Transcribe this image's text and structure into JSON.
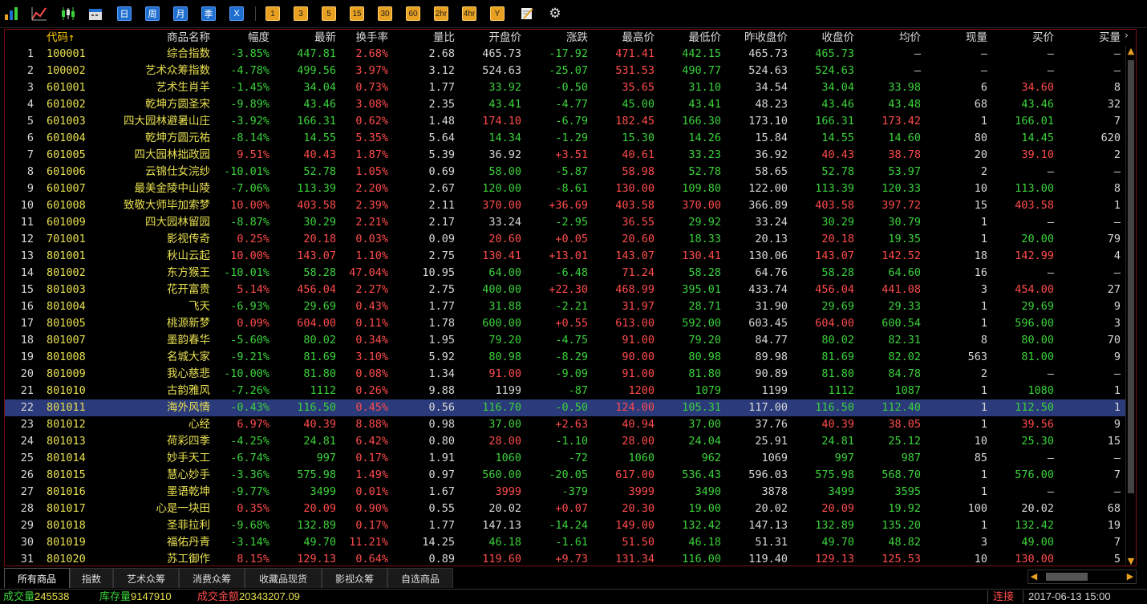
{
  "toolbar": {
    "icons": [
      "bar-chart-icon",
      "line-chart-icon",
      "candlestick-icon",
      "calendar-icon"
    ],
    "period_buttons": [
      "日",
      "周",
      "月",
      "季",
      "X"
    ],
    "interval_buttons": [
      "1",
      "3",
      "5",
      "15",
      "30",
      "60",
      "2hr",
      "4hr",
      "Y"
    ],
    "tools": [
      "note-icon",
      "gear-icon"
    ]
  },
  "table": {
    "headers": {
      "code": "代码↑",
      "name": "商品名称",
      "change_pct": "幅度",
      "last": "最新",
      "turnover": "换手率",
      "volume_ratio": "量比",
      "open": "开盘价",
      "change": "涨跌",
      "high": "最高价",
      "low": "最低价",
      "prev_close": "昨收盘价",
      "close": "收盘价",
      "avg": "均价",
      "cur_vol": "现量",
      "bid": "买价",
      "bid_vol": "买量"
    },
    "rows": [
      {
        "idx": "1",
        "code": "100001",
        "name": "综合指数",
        "pct": "-3.85%",
        "last": "447.81",
        "turn": "2.68%",
        "vr": "2.68",
        "open": "465.73",
        "chg": "-17.92",
        "high": "471.41",
        "low": "442.15",
        "prev": "465.73",
        "close": "465.73",
        "avg": "—",
        "cv": "—",
        "bid": "—",
        "bv": "—"
      },
      {
        "idx": "2",
        "code": "100002",
        "name": "艺术众筹指数",
        "pct": "-4.78%",
        "last": "499.56",
        "turn": "3.97%",
        "vr": "3.12",
        "open": "524.63",
        "chg": "-25.07",
        "high": "531.53",
        "low": "490.77",
        "prev": "524.63",
        "close": "524.63",
        "avg": "—",
        "cv": "—",
        "bid": "—",
        "bv": "—"
      },
      {
        "idx": "3",
        "code": "601001",
        "name": "艺术生肖羊",
        "pct": "-1.45%",
        "last": "34.04",
        "turn": "0.73%",
        "vr": "1.77",
        "open": "33.92",
        "chg": "-0.50",
        "high": "35.65",
        "low": "31.10",
        "prev": "34.54",
        "close": "34.04",
        "avg": "33.98",
        "cv": "6",
        "bid": "34.60",
        "bv": "8"
      },
      {
        "idx": "4",
        "code": "601002",
        "name": "乾坤方圆圣宋",
        "pct": "-9.89%",
        "last": "43.46",
        "turn": "3.08%",
        "vr": "2.35",
        "open": "43.41",
        "chg": "-4.77",
        "high": "45.00",
        "low": "43.41",
        "prev": "48.23",
        "close": "43.46",
        "avg": "43.48",
        "cv": "68",
        "bid": "43.46",
        "bv": "32"
      },
      {
        "idx": "5",
        "code": "601003",
        "name": "四大园林避暑山庄",
        "pct": "-3.92%",
        "last": "166.31",
        "turn": "0.62%",
        "vr": "1.48",
        "open": "174.10",
        "chg": "-6.79",
        "high": "182.45",
        "low": "166.30",
        "prev": "173.10",
        "close": "166.31",
        "avg": "173.42",
        "cv": "1",
        "bid": "166.01",
        "bv": "7"
      },
      {
        "idx": "6",
        "code": "601004",
        "name": "乾坤方圆元祐",
        "pct": "-8.14%",
        "last": "14.55",
        "turn": "5.35%",
        "vr": "5.64",
        "open": "14.34",
        "chg": "-1.29",
        "high": "15.30",
        "low": "14.26",
        "prev": "15.84",
        "close": "14.55",
        "avg": "14.60",
        "cv": "80",
        "bid": "14.45",
        "bv": "620"
      },
      {
        "idx": "7",
        "code": "601005",
        "name": "四大园林拙政园",
        "pct": "9.51%",
        "last": "40.43",
        "turn": "1.87%",
        "vr": "5.39",
        "open": "36.92",
        "chg": "+3.51",
        "high": "40.61",
        "low": "33.23",
        "prev": "36.92",
        "close": "40.43",
        "avg": "38.78",
        "cv": "20",
        "bid": "39.10",
        "bv": "2"
      },
      {
        "idx": "8",
        "code": "601006",
        "name": "云锦仕女浣纱",
        "pct": "-10.01%",
        "last": "52.78",
        "turn": "1.05%",
        "vr": "0.69",
        "open": "58.00",
        "chg": "-5.87",
        "high": "58.98",
        "low": "52.78",
        "prev": "58.65",
        "close": "52.78",
        "avg": "53.97",
        "cv": "2",
        "bid": "—",
        "bv": "—"
      },
      {
        "idx": "9",
        "code": "601007",
        "name": "最美金陵中山陵",
        "pct": "-7.06%",
        "last": "113.39",
        "turn": "2.20%",
        "vr": "2.67",
        "open": "120.00",
        "chg": "-8.61",
        "high": "130.00",
        "low": "109.80",
        "prev": "122.00",
        "close": "113.39",
        "avg": "120.33",
        "cv": "10",
        "bid": "113.00",
        "bv": "8"
      },
      {
        "idx": "10",
        "code": "601008",
        "name": "致敬大师毕加索梦",
        "pct": "10.00%",
        "last": "403.58",
        "turn": "2.39%",
        "vr": "2.11",
        "open": "370.00",
        "chg": "+36.69",
        "high": "403.58",
        "low": "370.00",
        "prev": "366.89",
        "close": "403.58",
        "avg": "397.72",
        "cv": "15",
        "bid": "403.58",
        "bv": "1"
      },
      {
        "idx": "11",
        "code": "601009",
        "name": "四大园林留园",
        "pct": "-8.87%",
        "last": "30.29",
        "turn": "2.21%",
        "vr": "2.17",
        "open": "33.24",
        "chg": "-2.95",
        "high": "36.55",
        "low": "29.92",
        "prev": "33.24",
        "close": "30.29",
        "avg": "30.79",
        "cv": "1",
        "bid": "—",
        "bv": "—"
      },
      {
        "idx": "12",
        "code": "701001",
        "name": "影视传奇",
        "pct": "0.25%",
        "last": "20.18",
        "turn": "0.03%",
        "vr": "0.09",
        "open": "20.60",
        "chg": "+0.05",
        "high": "20.60",
        "low": "18.33",
        "prev": "20.13",
        "close": "20.18",
        "avg": "19.35",
        "cv": "1",
        "bid": "20.00",
        "bv": "79"
      },
      {
        "idx": "13",
        "code": "801001",
        "name": "秋山云起",
        "pct": "10.00%",
        "last": "143.07",
        "turn": "1.10%",
        "vr": "2.75",
        "open": "130.41",
        "chg": "+13.01",
        "high": "143.07",
        "low": "130.41",
        "prev": "130.06",
        "close": "143.07",
        "avg": "142.52",
        "cv": "18",
        "bid": "142.99",
        "bv": "4"
      },
      {
        "idx": "14",
        "code": "801002",
        "name": "东方猴王",
        "pct": "-10.01%",
        "last": "58.28",
        "turn": "47.04%",
        "vr": "10.95",
        "open": "64.00",
        "chg": "-6.48",
        "high": "71.24",
        "low": "58.28",
        "prev": "64.76",
        "close": "58.28",
        "avg": "64.60",
        "cv": "16",
        "bid": "—",
        "bv": "—"
      },
      {
        "idx": "15",
        "code": "801003",
        "name": "花开富贵",
        "pct": "5.14%",
        "last": "456.04",
        "turn": "2.27%",
        "vr": "2.75",
        "open": "400.00",
        "chg": "+22.30",
        "high": "468.99",
        "low": "395.01",
        "prev": "433.74",
        "close": "456.04",
        "avg": "441.08",
        "cv": "3",
        "bid": "454.00",
        "bv": "27"
      },
      {
        "idx": "16",
        "code": "801004",
        "name": "飞天",
        "pct": "-6.93%",
        "last": "29.69",
        "turn": "0.43%",
        "vr": "1.77",
        "open": "31.88",
        "chg": "-2.21",
        "high": "31.97",
        "low": "28.71",
        "prev": "31.90",
        "close": "29.69",
        "avg": "29.33",
        "cv": "1",
        "bid": "29.69",
        "bv": "9"
      },
      {
        "idx": "17",
        "code": "801005",
        "name": "桃源新梦",
        "pct": "0.09%",
        "last": "604.00",
        "turn": "0.11%",
        "vr": "1.78",
        "open": "600.00",
        "chg": "+0.55",
        "high": "613.00",
        "low": "592.00",
        "prev": "603.45",
        "close": "604.00",
        "avg": "600.54",
        "cv": "1",
        "bid": "596.00",
        "bv": "3"
      },
      {
        "idx": "18",
        "code": "801007",
        "name": "墨韵春华",
        "pct": "-5.60%",
        "last": "80.02",
        "turn": "0.34%",
        "vr": "1.95",
        "open": "79.20",
        "chg": "-4.75",
        "high": "91.00",
        "low": "79.20",
        "prev": "84.77",
        "close": "80.02",
        "avg": "82.31",
        "cv": "8",
        "bid": "80.00",
        "bv": "70"
      },
      {
        "idx": "19",
        "code": "801008",
        "name": "名城大家",
        "pct": "-9.21%",
        "last": "81.69",
        "turn": "3.10%",
        "vr": "5.92",
        "open": "80.98",
        "chg": "-8.29",
        "high": "90.00",
        "low": "80.98",
        "prev": "89.98",
        "close": "81.69",
        "avg": "82.02",
        "cv": "563",
        "bid": "81.00",
        "bv": "9"
      },
      {
        "idx": "20",
        "code": "801009",
        "name": "我心慈悲",
        "pct": "-10.00%",
        "last": "81.80",
        "turn": "0.08%",
        "vr": "1.34",
        "open": "91.00",
        "chg": "-9.09",
        "high": "91.00",
        "low": "81.80",
        "prev": "90.89",
        "close": "81.80",
        "avg": "84.78",
        "cv": "2",
        "bid": "—",
        "bv": "—"
      },
      {
        "idx": "21",
        "code": "801010",
        "name": "古韵雅风",
        "pct": "-7.26%",
        "last": "1112",
        "turn": "0.26%",
        "vr": "9.88",
        "open": "1199",
        "chg": "-87",
        "high": "1200",
        "low": "1079",
        "prev": "1199",
        "close": "1112",
        "avg": "1087",
        "cv": "1",
        "bid": "1080",
        "bv": "1"
      },
      {
        "idx": "22",
        "code": "801011",
        "name": "海外风情",
        "pct": "-0.43%",
        "last": "116.50",
        "turn": "0.45%",
        "vr": "0.56",
        "open": "116.70",
        "chg": "-0.50",
        "high": "124.00",
        "low": "105.31",
        "prev": "117.00",
        "close": "116.50",
        "avg": "112.40",
        "cv": "1",
        "bid": "112.50",
        "bv": "1"
      },
      {
        "idx": "23",
        "code": "801012",
        "name": "心经",
        "pct": "6.97%",
        "last": "40.39",
        "turn": "8.88%",
        "vr": "0.98",
        "open": "37.00",
        "chg": "+2.63",
        "high": "40.94",
        "low": "37.00",
        "prev": "37.76",
        "close": "40.39",
        "avg": "38.05",
        "cv": "1",
        "bid": "39.56",
        "bv": "9"
      },
      {
        "idx": "24",
        "code": "801013",
        "name": "荷彩四季",
        "pct": "-4.25%",
        "last": "24.81",
        "turn": "6.42%",
        "vr": "0.80",
        "open": "28.00",
        "chg": "-1.10",
        "high": "28.00",
        "low": "24.04",
        "prev": "25.91",
        "close": "24.81",
        "avg": "25.12",
        "cv": "10",
        "bid": "25.30",
        "bv": "15"
      },
      {
        "idx": "25",
        "code": "801014",
        "name": "妙手天工",
        "pct": "-6.74%",
        "last": "997",
        "turn": "0.17%",
        "vr": "1.91",
        "open": "1060",
        "chg": "-72",
        "high": "1060",
        "low": "962",
        "prev": "1069",
        "close": "997",
        "avg": "987",
        "cv": "85",
        "bid": "—",
        "bv": "—"
      },
      {
        "idx": "26",
        "code": "801015",
        "name": "慧心妙手",
        "pct": "-3.36%",
        "last": "575.98",
        "turn": "1.49%",
        "vr": "0.97",
        "open": "560.00",
        "chg": "-20.05",
        "high": "617.00",
        "low": "536.43",
        "prev": "596.03",
        "close": "575.98",
        "avg": "568.70",
        "cv": "1",
        "bid": "576.00",
        "bv": "7"
      },
      {
        "idx": "27",
        "code": "801016",
        "name": "墨语乾坤",
        "pct": "-9.77%",
        "last": "3499",
        "turn": "0.01%",
        "vr": "1.67",
        "open": "3999",
        "chg": "-379",
        "high": "3999",
        "low": "3490",
        "prev": "3878",
        "close": "3499",
        "avg": "3595",
        "cv": "1",
        "bid": "—",
        "bv": "—"
      },
      {
        "idx": "28",
        "code": "801017",
        "name": "心是一块田",
        "pct": "0.35%",
        "last": "20.09",
        "turn": "0.90%",
        "vr": "0.55",
        "open": "20.02",
        "chg": "+0.07",
        "high": "20.30",
        "low": "19.00",
        "prev": "20.02",
        "close": "20.09",
        "avg": "19.92",
        "cv": "100",
        "bid": "20.02",
        "bv": "68"
      },
      {
        "idx": "29",
        "code": "801018",
        "name": "圣菲拉利",
        "pct": "-9.68%",
        "last": "132.89",
        "turn": "0.17%",
        "vr": "1.77",
        "open": "147.13",
        "chg": "-14.24",
        "high": "149.00",
        "low": "132.42",
        "prev": "147.13",
        "close": "132.89",
        "avg": "135.20",
        "cv": "1",
        "bid": "132.42",
        "bv": "19"
      },
      {
        "idx": "30",
        "code": "801019",
        "name": "福佑丹青",
        "pct": "-3.14%",
        "last": "49.70",
        "turn": "11.21%",
        "vr": "14.25",
        "open": "46.18",
        "chg": "-1.61",
        "high": "51.50",
        "low": "46.18",
        "prev": "51.31",
        "close": "49.70",
        "avg": "48.82",
        "cv": "3",
        "bid": "49.00",
        "bv": "7"
      },
      {
        "idx": "31",
        "code": "801020",
        "name": "苏工御作",
        "pct": "8.15%",
        "last": "129.13",
        "turn": "0.64%",
        "vr": "0.89",
        "open": "119.60",
        "chg": "+9.73",
        "high": "131.34",
        "low": "116.00",
        "prev": "119.40",
        "close": "129.13",
        "avg": "125.53",
        "cv": "10",
        "bid": "130.00",
        "bv": "5"
      }
    ]
  },
  "tabs": [
    "所有商品",
    "指数",
    "艺术众筹",
    "消费众筹",
    "收藏品现货",
    "影视众筹",
    "自选商品"
  ],
  "status": {
    "volume_label": "成交量",
    "volume": "245538",
    "stock_label": "库存量",
    "stock": "9147910",
    "amount_label": "成交金额",
    "amount": "20343207.09",
    "connection": "连接",
    "datetime": "2017-06-13 15:00"
  },
  "colors": {
    "up": "#ff4b4b",
    "down": "#3bd23b",
    "highlight": "#2a3a7a",
    "code": "#e8e050"
  }
}
